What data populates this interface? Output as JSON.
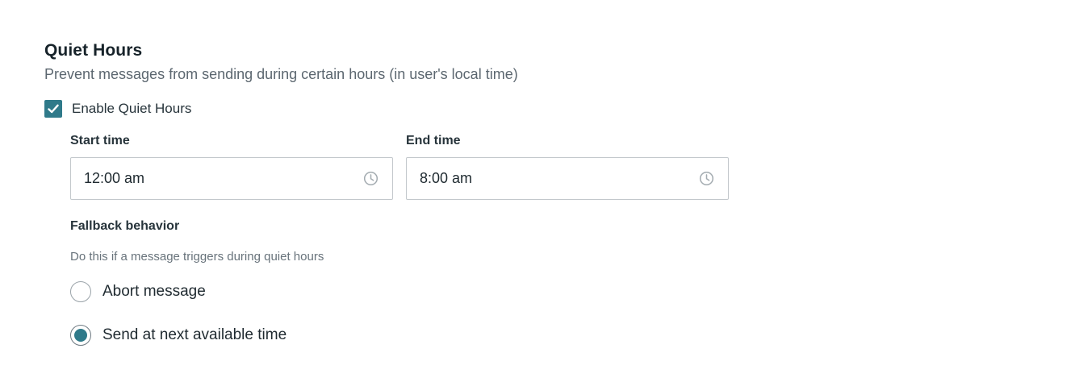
{
  "quiet_hours": {
    "title": "Quiet Hours",
    "subtitle": "Prevent messages from sending during certain hours (in user's local time)",
    "enable": {
      "label": "Enable Quiet Hours",
      "checked": true
    },
    "start_time": {
      "label": "Start time",
      "value": "12:00 am",
      "icon": "clock-icon"
    },
    "end_time": {
      "label": "End time",
      "value": "8:00 am",
      "icon": "clock-icon"
    },
    "fallback": {
      "title": "Fallback behavior",
      "description": "Do this if a message triggers during quiet hours",
      "options": [
        {
          "label": "Abort message",
          "selected": false
        },
        {
          "label": "Send at next available time",
          "selected": true
        }
      ]
    }
  },
  "colors": {
    "accent": "#2f7a8a",
    "input_border": "#c3c8cc",
    "muted_text": "#5c6770"
  }
}
